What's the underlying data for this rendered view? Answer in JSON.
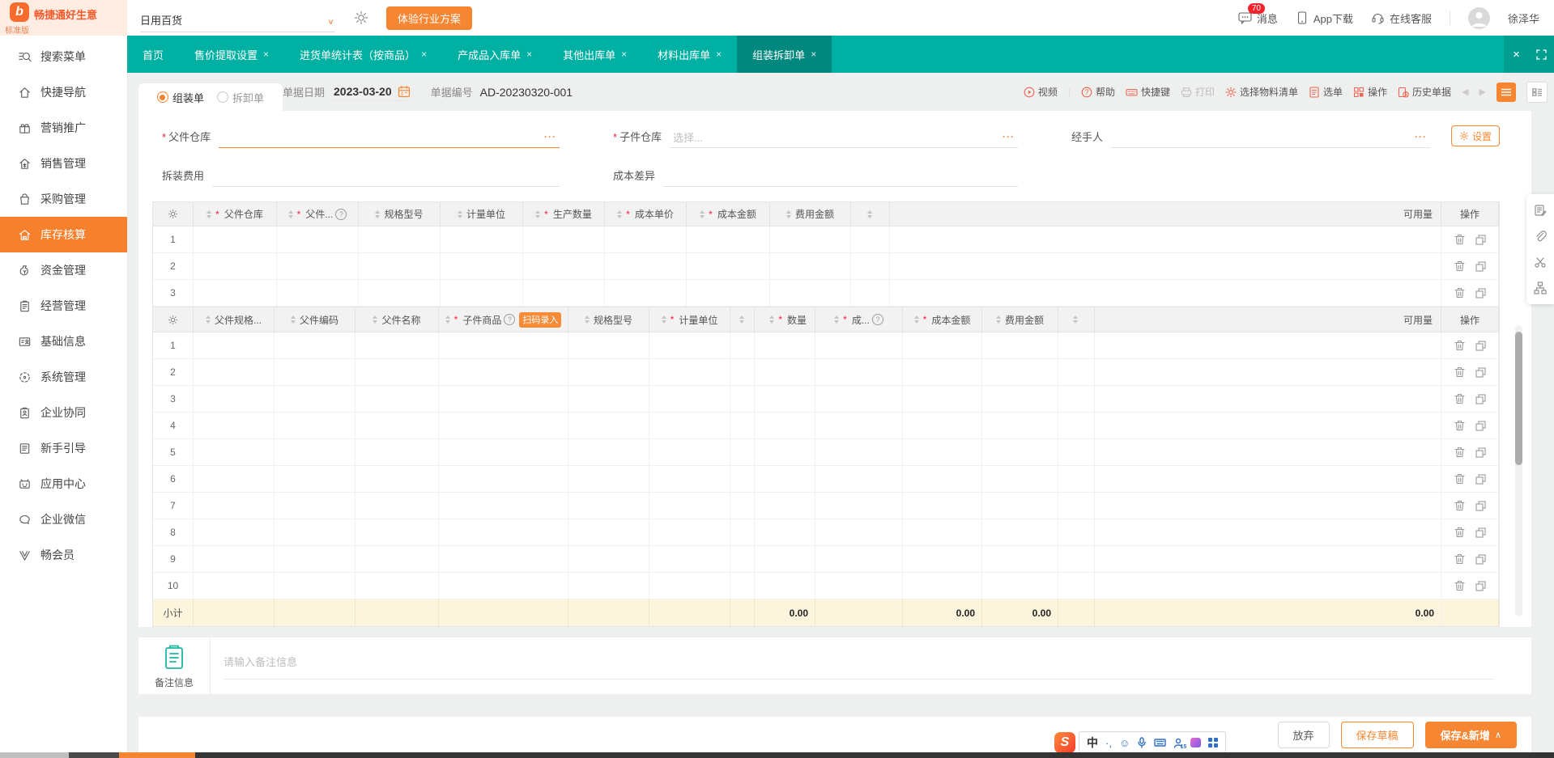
{
  "topbar": {
    "brand": {
      "name": "畅捷通好生意",
      "edition": "标准版",
      "logo_letter": "b"
    },
    "store_select": {
      "value": "日用百货"
    },
    "solution_button": "体验行业方案",
    "messages": "消息",
    "messages_badge": "70",
    "app_download": "App下载",
    "online_service": "在线客服",
    "username": "徐泽华"
  },
  "tabbar": {
    "tabs": [
      {
        "label": "首页"
      },
      {
        "label": "售价提取设置"
      },
      {
        "label": "进货单统计表（按商品）"
      },
      {
        "label": "产成品入库单"
      },
      {
        "label": "其他出库单"
      },
      {
        "label": "材料出库单"
      },
      {
        "label": "组装拆卸单"
      }
    ]
  },
  "sidebar": {
    "items": [
      {
        "label": "搜索菜单"
      },
      {
        "label": "快捷导航"
      },
      {
        "label": "营销推广"
      },
      {
        "label": "销售管理"
      },
      {
        "label": "采购管理"
      },
      {
        "label": "库存核算",
        "active": true
      },
      {
        "label": "资金管理"
      },
      {
        "label": "经营管理"
      },
      {
        "label": "基础信息"
      },
      {
        "label": "系统管理"
      },
      {
        "label": "企业协同"
      },
      {
        "label": "新手引导"
      },
      {
        "label": "应用中心"
      },
      {
        "label": "企业微信"
      },
      {
        "label": "畅会员"
      }
    ]
  },
  "doc_toolbar": {
    "radio_assembly": "组装单",
    "radio_disassembly": "拆卸单",
    "date_label": "单据日期",
    "date_value": "2023-03-20",
    "no_label": "单据编号",
    "no_value": "AD-20230320-001",
    "actions": [
      {
        "label": "视频"
      },
      {
        "label": "帮助"
      },
      {
        "label": "快捷键"
      },
      {
        "label": "打印",
        "disabled": true
      },
      {
        "label": "选择物料清单"
      },
      {
        "label": "选单"
      },
      {
        "label": "操作"
      },
      {
        "label": "历史单据"
      }
    ]
  },
  "form": {
    "parent_wh_label": "父件仓库",
    "child_wh_label": "子件仓库",
    "child_wh_placeholder": "选择...",
    "handler_label": "经手人",
    "settings_button": "设置",
    "fee_label": "拆装费用",
    "cost_diff_label": "成本差异"
  },
  "table_parent": {
    "columns": [
      {
        "label": ""
      },
      {
        "label": "父件仓库",
        "required": true
      },
      {
        "label": "父件...",
        "required": true,
        "help": true
      },
      {
        "label": "规格型号"
      },
      {
        "label": "计量单位"
      },
      {
        "label": "生产数量",
        "required": true
      },
      {
        "label": "成本单价",
        "required": true
      },
      {
        "label": "成本金额",
        "required": true
      },
      {
        "label": "费用金额"
      },
      {
        "label": ""
      }
    ],
    "usable_label": "可用量",
    "action_label": "操作",
    "row_numbers": [
      "1",
      "2",
      "3"
    ]
  },
  "table_child": {
    "columns": [
      {
        "label": ""
      },
      {
        "label": "父件规格..."
      },
      {
        "label": "父件编码"
      },
      {
        "label": "父件名称"
      },
      {
        "label": "子件商品",
        "required": true,
        "help": true
      },
      {
        "label": "规格型号"
      },
      {
        "label": "计量单位",
        "required": true
      },
      {
        "label": ""
      },
      {
        "label": "数量",
        "required": true
      },
      {
        "label": "成...",
        "required": true,
        "help": true
      },
      {
        "label": "成本金额",
        "required": true
      },
      {
        "label": "费用金额"
      },
      {
        "label": ""
      }
    ],
    "scan_badge": "扫码录入",
    "usable_label": "可用量",
    "action_label": "操作",
    "row_numbers": [
      "1",
      "2",
      "3",
      "4",
      "5",
      "6",
      "7",
      "8",
      "9",
      "10"
    ],
    "subtotal_label": "小计",
    "subtotal": {
      "qty": "0.00",
      "cost_amount": "0.00",
      "fee_amount": "0.00",
      "usable": "0.00"
    }
  },
  "remark": {
    "label": "备注信息",
    "placeholder": "请输入备注信息"
  },
  "footer": {
    "discard": "放弃",
    "save_draft": "保存草稿",
    "save_new": "保存&新增"
  },
  "ime": {
    "logo": "S",
    "mode": "中",
    "punct": "·,",
    "smiley": "☺",
    "count": "15"
  },
  "glyphs": {
    "required": "*",
    "help": "?",
    "ellipsis": "···",
    "close": "×",
    "chevron_down": "∨",
    "prev": "◀",
    "next": "▶",
    "caret_up": "∧",
    "pipe": "|",
    "vip": "V"
  },
  "colors": {
    "teal": "#00b0a2",
    "teal_dark": "#00877e",
    "orange": "#f78632",
    "red": "#f5222d",
    "subtotal_bg": "#fcf4dd"
  }
}
